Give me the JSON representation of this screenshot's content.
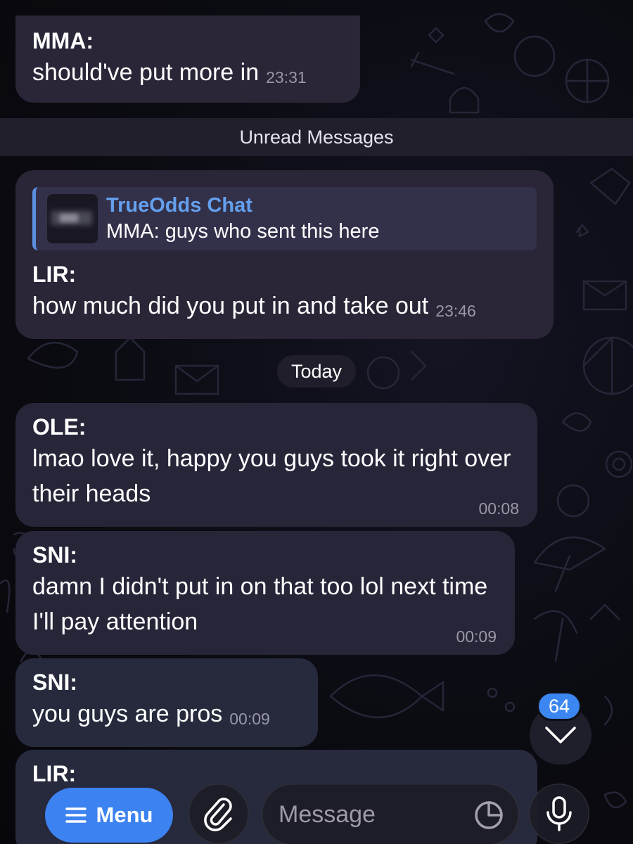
{
  "divider": {
    "unread_label": "Unread Messages"
  },
  "date_separator": "Today",
  "messages": [
    {
      "sender": "MMA:",
      "text": "should've put more in",
      "time": "23:31"
    },
    {
      "reply": {
        "title": "TrueOdds Chat",
        "text": "MMA: guys who sent this here"
      },
      "sender": "LIR:",
      "text": "how much did you put in and take out",
      "time": "23:46"
    },
    {
      "sender": "OLE:",
      "text": "lmao love it, happy you guys took it right over their heads",
      "time": "00:08"
    },
    {
      "sender": "SNI:",
      "text": "damn I didn't put in on that too lol next time I'll pay attention",
      "time": "00:09"
    },
    {
      "sender": "SNI:",
      "text": "you guys are pros",
      "time": "00:09"
    },
    {
      "sender": "LIR:",
      "text": ""
    }
  ],
  "scroll": {
    "unread_count": "64"
  },
  "input_bar": {
    "menu_label": "Menu",
    "message_placeholder": "Message"
  },
  "icons": {
    "menu": "hamburger-icon",
    "attach": "paperclip-icon",
    "sticker": "sticker-icon",
    "voice": "microphone-icon",
    "scroll": "chevron-down-icon"
  },
  "colors": {
    "background": "#09090d",
    "bubble": "#2a2537",
    "accent": "#3c82f0",
    "reply_title": "#64a0ee"
  }
}
